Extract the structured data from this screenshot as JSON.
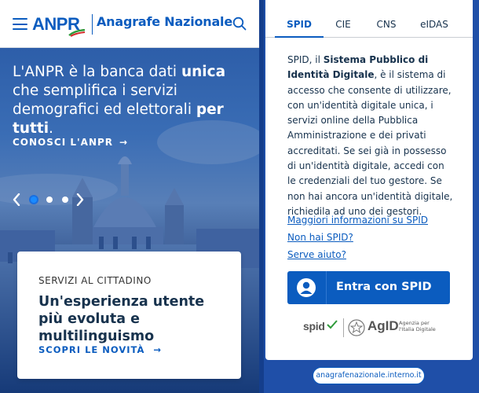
{
  "left": {
    "header": {
      "logo_text": "ANPR",
      "app_title": "Anagrafe Nazionale"
    },
    "hero": {
      "headline_part1": "L'ANPR è la banca dati ",
      "headline_bold1": "unica",
      "headline_part2": " che semplifica i servizi demografici ed elettorali ",
      "headline_bold2": "per tutti",
      "headline_part3": ".",
      "link_label": "CONOSCI L'ANPR",
      "carousel": {
        "total": 3,
        "active": 1
      }
    },
    "card": {
      "kicker": "SERVIZI AL CITTADINO",
      "title": "Un'esperienza utente più evoluta e multilinguismo",
      "cta": "SCOPRI LE NOVITÀ"
    }
  },
  "right": {
    "tabs": [
      {
        "label": "SPID",
        "active": true
      },
      {
        "label": "CIE",
        "active": false
      },
      {
        "label": "CNS",
        "active": false
      },
      {
        "label": "eIDAS",
        "active": false
      }
    ],
    "description": {
      "part1": "SPID, il ",
      "bold": "Sistema Pubblico di Identità Digitale",
      "part2": ", è il sistema di accesso che consente di utilizzare, con un'identità digitale unica, i servizi online della Pubblica Amministrazione e dei privati accreditati. Se sei già in possesso di un'identità digitale, accedi con le credenziali del tuo gestore. Se non hai ancora un'identità digitale, richiedila ad uno dei gestori."
    },
    "links": [
      "Maggiori informazioni su SPID",
      "Non hai SPID?",
      "Serve aiuto?"
    ],
    "spid_button": "Entra con SPID",
    "logos": {
      "spid": "spid",
      "agid": "AgID",
      "agid_sub": "Agenzia per l'Italia Digitale"
    },
    "url_pill": "anagrafenazionale.interno.it"
  },
  "colors": {
    "brand_blue": "#0b5cbf",
    "dark_text": "#17324d",
    "background_blue": "#1f4fa8"
  }
}
